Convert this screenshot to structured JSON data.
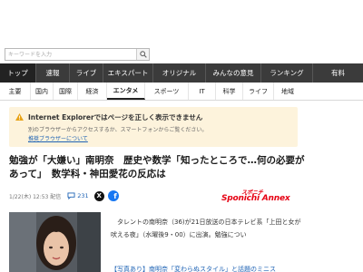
{
  "search": {
    "placeholder": "キーワードを入力",
    "button_icon": "search-icon"
  },
  "main_nav": {
    "items": [
      {
        "label": "トップ",
        "active": true
      },
      {
        "label": "速報",
        "active": false
      },
      {
        "label": "ライブ",
        "active": false
      },
      {
        "label": "エキスパート",
        "active": false
      },
      {
        "label": "オリジナル",
        "active": false
      },
      {
        "label": "みんなの意見",
        "active": false
      },
      {
        "label": "ランキング",
        "active": false
      },
      {
        "label": "有料",
        "active": false
      }
    ]
  },
  "sub_nav": {
    "items": [
      {
        "label": "主要",
        "active": false
      },
      {
        "label": "国内",
        "active": false
      },
      {
        "label": "国際",
        "active": false
      },
      {
        "label": "経済",
        "active": false
      },
      {
        "label": "エンタメ",
        "active": true
      },
      {
        "label": "スポーツ",
        "active": false
      },
      {
        "label": "IT",
        "active": false
      },
      {
        "label": "科学",
        "active": false
      },
      {
        "label": "ライフ",
        "active": false
      },
      {
        "label": "地域",
        "active": false
      }
    ]
  },
  "ie_warning": {
    "title": "Internet Explorerではページを正しく表示できません",
    "body": "別のブラウザーからアクセスするか、スマートフォンからご覧ください。",
    "link": "推奨ブラウザーについて",
    "icon": "warning-icon",
    "color": "#e8a317"
  },
  "article": {
    "headline": "勉強が「大嫌い」南明奈　歴史や数学「知ったところで…何の必要があって」　数学科・神田愛花の反応は",
    "date": "1/22(木) 12:53 配信",
    "comment_count": "231",
    "share_x": "X",
    "share_fb": "f",
    "source_logo_top": "スポニチ",
    "source_logo_main": "Sponichi Annex",
    "body": "タレントの南明奈（36)が21日放送の日本テレビ系「上田と女が吠える夜」（水曜後9・00）に出演。勉強につい",
    "related": "【写真あり】南明奈「変わらぬスタイル」と話題のミニス"
  },
  "colors": {
    "nav_bg": "#3b3b3b",
    "link": "#1e63b5",
    "brand_red": "#e60012",
    "facebook": "#1877f2"
  }
}
